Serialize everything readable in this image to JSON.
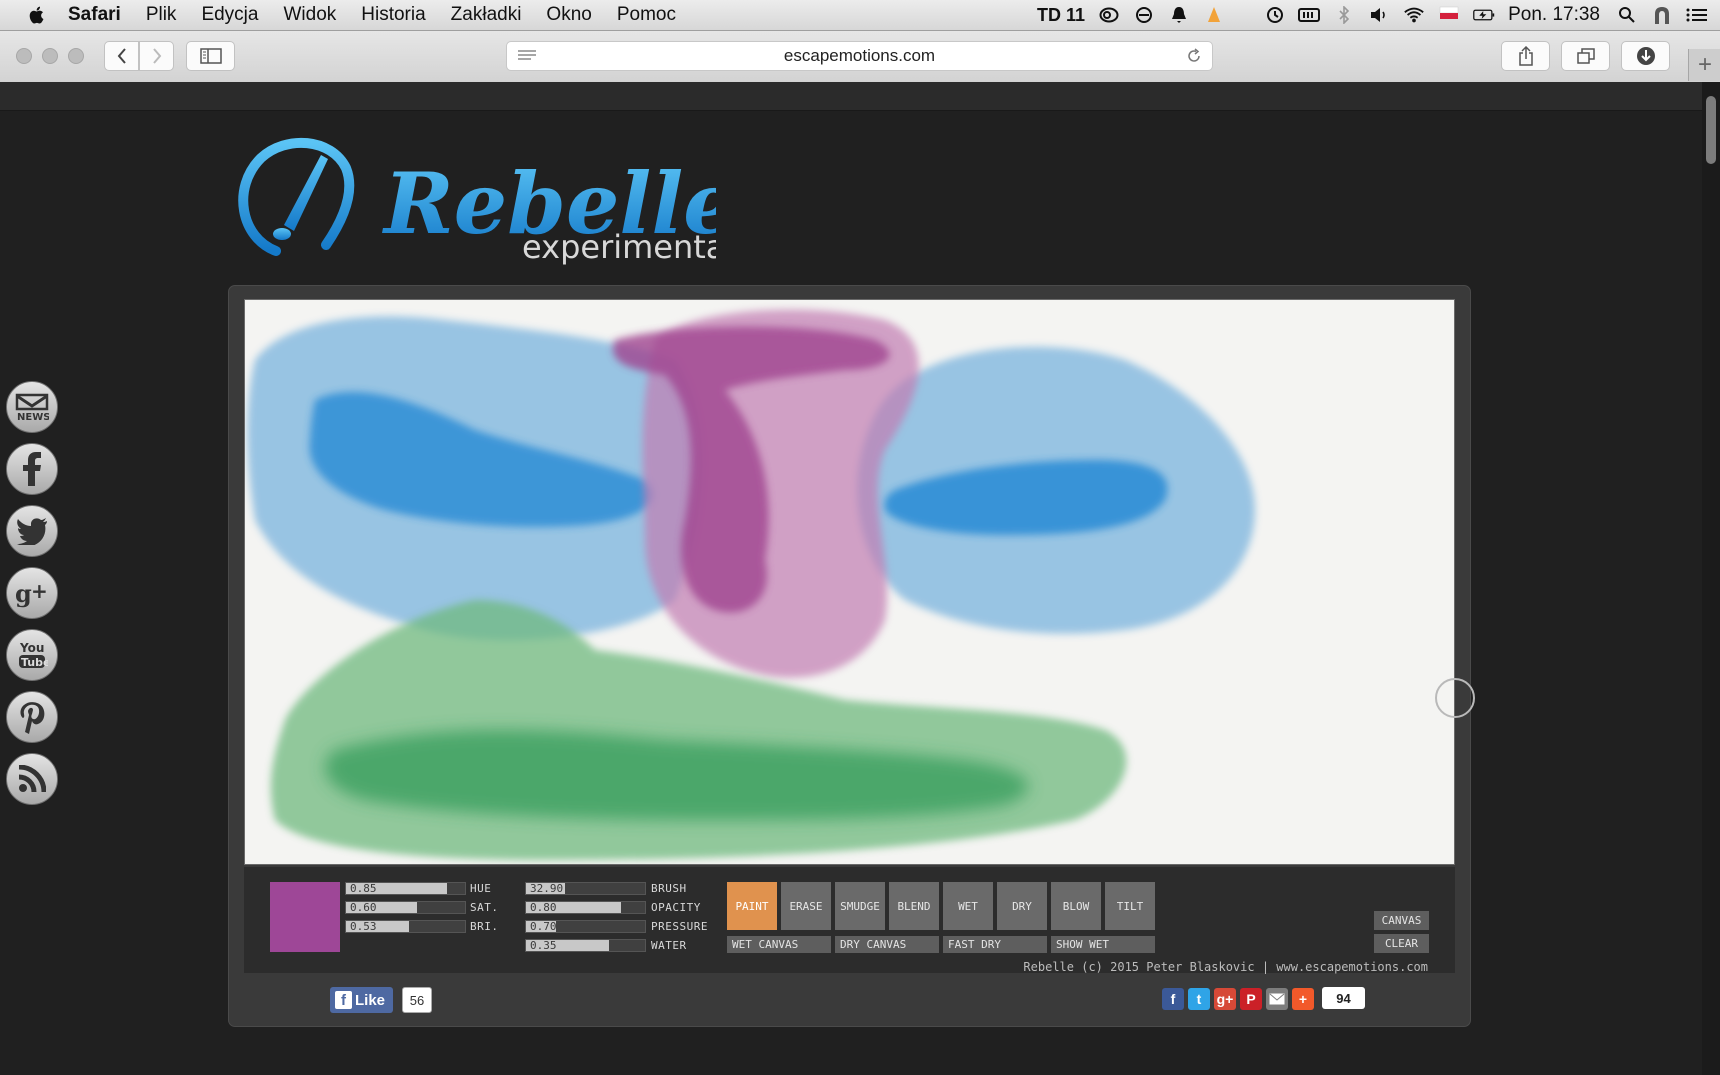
{
  "menubar": {
    "app": "Safari",
    "items": [
      "Plik",
      "Edycja",
      "Widok",
      "Historia",
      "Zakładki",
      "Okno",
      "Pomoc"
    ],
    "td_label": "TD 11",
    "clock": "Pon. 17:38"
  },
  "browser": {
    "url": "escapemotions.com"
  },
  "logo": {
    "title": "Rebelle",
    "subtitle": "experimental"
  },
  "color": {
    "swatch": "#9e4797",
    "hue": {
      "value": "0.85",
      "label": "HUE",
      "level": 0.85
    },
    "sat": {
      "value": "0.60",
      "label": "SAT.",
      "level": 0.6
    },
    "bri": {
      "value": "0.53",
      "label": "BRI.",
      "level": 0.53
    }
  },
  "brush": {
    "brush": {
      "value": "32.90",
      "label": "BRUSH",
      "level": 0.33
    },
    "opacity": {
      "value": "0.80",
      "label": "OPACITY",
      "level": 0.8
    },
    "pressure": {
      "value": "0.70",
      "label": "PRESSURE",
      "level": 0.25
    },
    "water": {
      "value": "0.35",
      "label": "WATER",
      "level": 0.7
    }
  },
  "modes": [
    "PAINT",
    "ERASE",
    "SMUDGE",
    "BLEND",
    "WET",
    "DRY",
    "BLOW",
    "TILT"
  ],
  "active_mode": "PAINT",
  "canvas_actions": [
    "WET CANVAS",
    "DRY CANVAS",
    "FAST DRY",
    "SHOW WET"
  ],
  "side_actions": {
    "canvas": "CANVAS",
    "clear": "CLEAR"
  },
  "credit": "Rebelle (c) 2015 Peter Blaskovic | www.escapemotions.com",
  "share": {
    "like_label": "Like",
    "like_count": "56",
    "share_count": "94"
  },
  "social_links": [
    "news-icon",
    "facebook-icon",
    "twitter-icon",
    "google-plus-icon",
    "youtube-icon",
    "pinterest-icon",
    "rss-icon"
  ]
}
